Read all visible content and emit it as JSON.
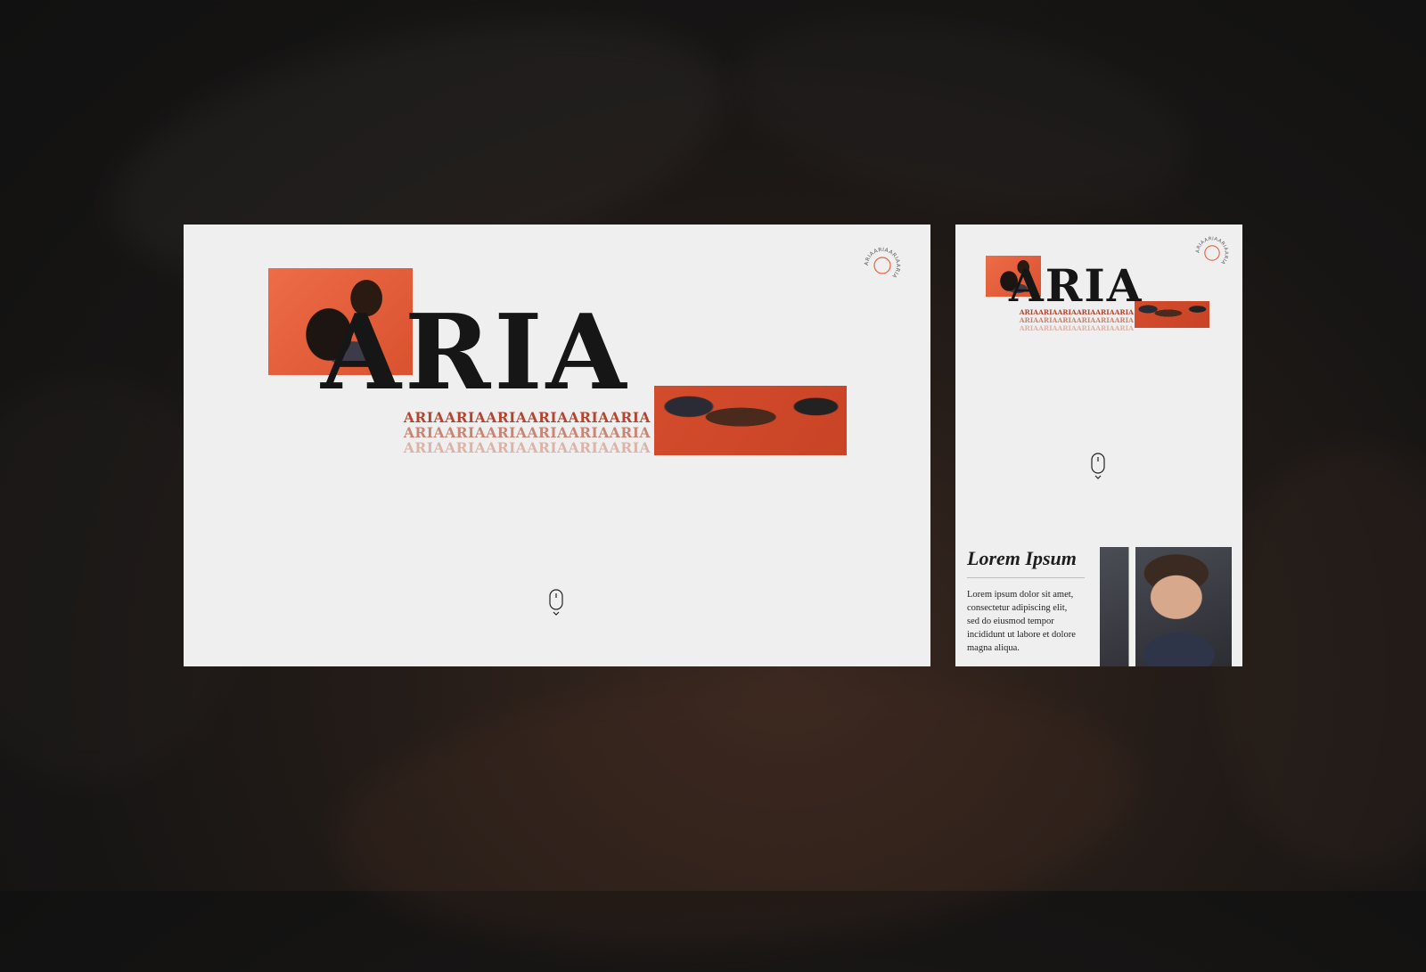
{
  "brand": {
    "title": "ARIA",
    "echo_lines": [
      "ARIAARIAARIAARIAARIAARIA",
      "ARIAARIAARIAARIAARIAARIA",
      "ARIAARIAARIAARIAARIAARIA"
    ],
    "badge_text": "ARIAARIAARIAARIA",
    "accent_color": "#e8613e"
  },
  "mobile": {
    "article": {
      "title": "Lorem Ipsum",
      "body": "Lorem ipsum dolor sit amet, consectetur adipiscing elit, sed do eiusmod tempor incididunt ut labore et dolore magna aliqua."
    }
  },
  "icons": {
    "badge": "circular-text-badge-icon",
    "scroll": "mouse-scroll-icon"
  }
}
